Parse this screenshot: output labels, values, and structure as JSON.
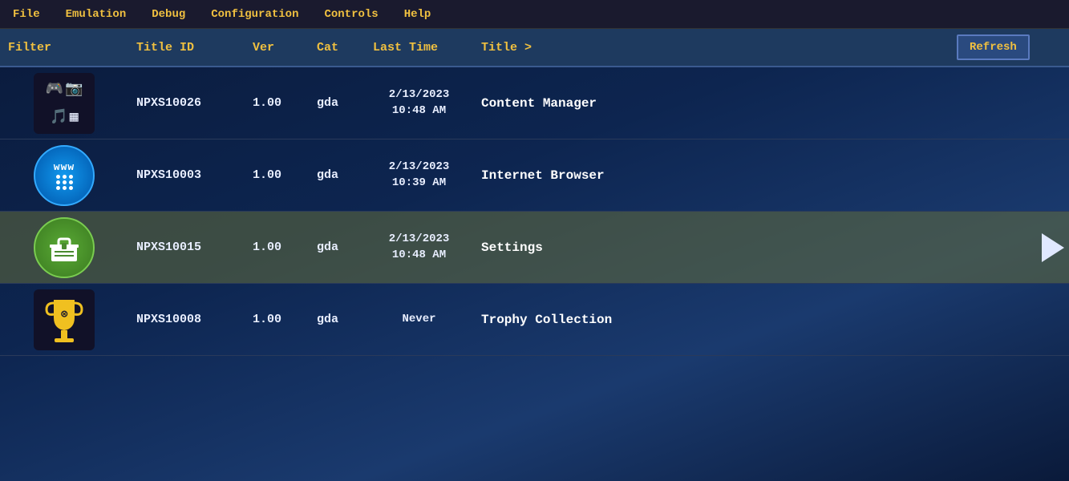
{
  "menubar": {
    "items": [
      {
        "label": "File",
        "id": "file"
      },
      {
        "label": "Emulation",
        "id": "emulation"
      },
      {
        "label": "Debug",
        "id": "debug"
      },
      {
        "label": "Configuration",
        "id": "configuration"
      },
      {
        "label": "Controls",
        "id": "controls"
      },
      {
        "label": "Help",
        "id": "help"
      }
    ]
  },
  "table": {
    "headers": {
      "filter": "Filter",
      "titleid": "Title ID",
      "ver": "Ver",
      "cat": "Cat",
      "lasttime": "Last Time",
      "title": "Title >",
      "refresh": "Refresh"
    },
    "rows": [
      {
        "id": "row-content-manager",
        "titleid": "NPXS10026",
        "ver": "1.00",
        "cat": "gda",
        "lasttime_line1": "2/13/2023",
        "lasttime_line2": "10:48 AM",
        "title": "Content Manager",
        "selected": false,
        "icon_type": "content-manager"
      },
      {
        "id": "row-browser",
        "titleid": "NPXS10003",
        "ver": "1.00",
        "cat": "gda",
        "lasttime_line1": "2/13/2023",
        "lasttime_line2": "10:39 AM",
        "title": "Internet Browser",
        "selected": false,
        "icon_type": "browser"
      },
      {
        "id": "row-settings",
        "titleid": "NPXS10015",
        "ver": "1.00",
        "cat": "gda",
        "lasttime_line1": "2/13/2023",
        "lasttime_line2": "10:48 AM",
        "title": "Settings",
        "selected": true,
        "icon_type": "settings"
      },
      {
        "id": "row-trophy",
        "titleid": "NPXS10008",
        "ver": "1.00",
        "cat": "gda",
        "lasttime_line1": "Never",
        "lasttime_line2": "",
        "title": "Trophy Collection",
        "selected": false,
        "icon_type": "trophy"
      }
    ]
  }
}
